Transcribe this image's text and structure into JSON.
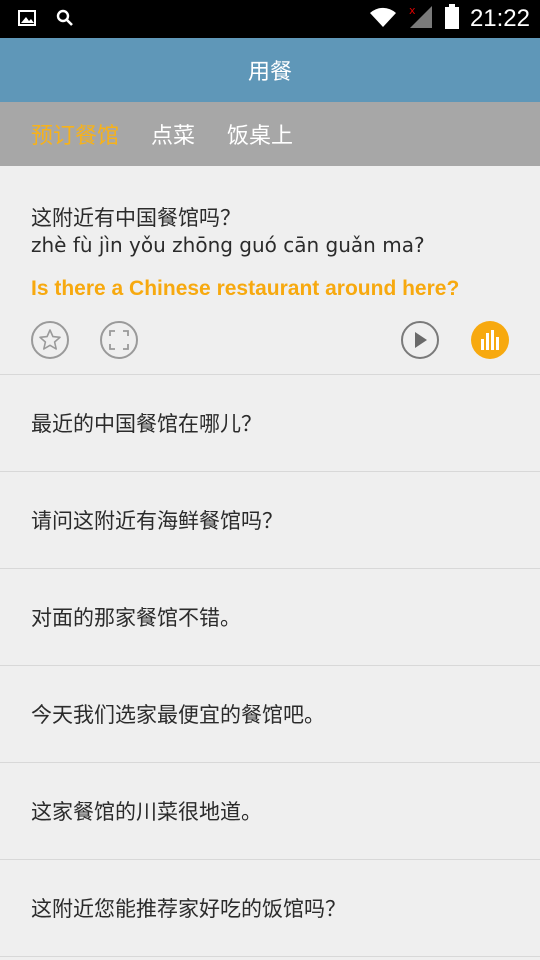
{
  "status_bar": {
    "time": "21:22",
    "left_icons": [
      "image-icon",
      "search-icon"
    ],
    "right_icons": [
      "wifi-icon",
      "signal-icon",
      "battery-icon"
    ]
  },
  "title": "用餐",
  "tabs": [
    {
      "label": "预订餐馆",
      "active": true
    },
    {
      "label": "点菜",
      "active": false
    },
    {
      "label": "饭桌上",
      "active": false
    }
  ],
  "expanded_item": {
    "chinese": "这附近有中国餐馆吗？",
    "pinyin": "zhè fù jìn yǒu zhōng guó cān guǎn ma?",
    "english": "Is there a Chinese restaurant around here?",
    "actions": [
      "star-icon",
      "expand-icon",
      "play-icon",
      "audio-bars-icon"
    ]
  },
  "phrases": [
    "最近的中国餐馆在哪儿？",
    "请问这附近有海鲜餐馆吗？",
    "对面的那家餐馆不错。",
    "今天我们选家最便宜的餐馆吧。",
    "这家餐馆的川菜很地道。",
    "这附近您能推荐家好吃的饭馆吗？"
  ],
  "colors": {
    "title_bar": "#5f97b8",
    "tab_bar": "#a7a7a7",
    "accent": "#f7a90f",
    "background": "#efefef"
  }
}
